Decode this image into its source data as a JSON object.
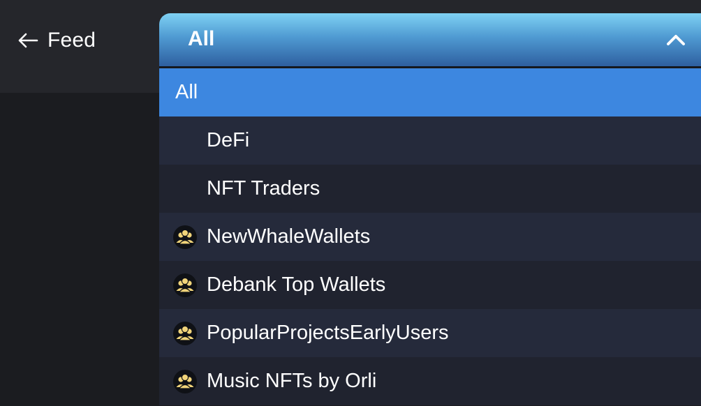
{
  "header": {
    "back_label": "Feed"
  },
  "dropdown": {
    "selected": "All",
    "options": [
      {
        "label": "All",
        "icon": ""
      },
      {
        "label": "DeFi",
        "icon": ""
      },
      {
        "label": "NFT Traders",
        "icon": ""
      },
      {
        "label": "NewWhaleWallets",
        "icon": "user-group-icon"
      },
      {
        "label": "Debank Top Wallets",
        "icon": "user-group-icon"
      },
      {
        "label": "PopularProjectsEarlyUsers",
        "icon": "user-group-icon"
      },
      {
        "label": "Music NFTs by Orli",
        "icon": "user-group-icon"
      }
    ]
  },
  "colors": {
    "active_option": "#3d87e0",
    "toggle_top": "#7fd1f3",
    "toggle_bottom": "#2e5fa0",
    "badge_icon": "#f1d47a"
  }
}
